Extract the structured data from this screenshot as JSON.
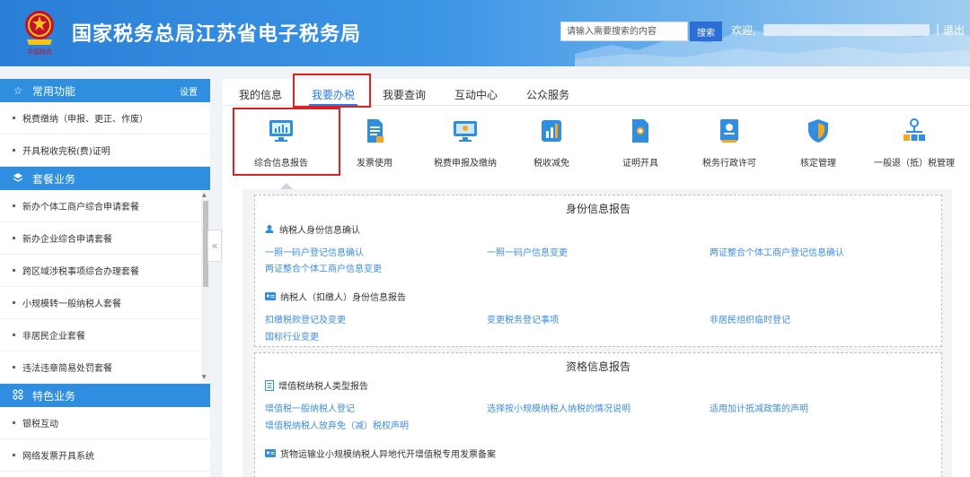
{
  "header": {
    "site_title": "国家税务总局江苏省电子税务局",
    "search_placeholder": "请输入需要搜索的内容",
    "search_button": "搜索",
    "welcome": "欢迎,",
    "separator": "|",
    "logout": "退出"
  },
  "sidebar": {
    "sections": [
      {
        "title": "常用功能",
        "icon": "star-icon",
        "action": "设置",
        "items": [
          "税费缴纳（申报、更正、作废）",
          "开具税收完税(费)证明"
        ]
      },
      {
        "title": "套餐业务",
        "icon": "layers-icon",
        "items": [
          "新办个体工商户综合申请套餐",
          "新办企业综合申请套餐",
          "跨区域涉税事项综合办理套餐",
          "小规模转一般纳税人套餐",
          "非居民企业套餐",
          "违法违章简易处罚套餐"
        ]
      },
      {
        "title": "特色业务",
        "icon": "grid-icon",
        "items": [
          "银税互动",
          "网络发票开具系统"
        ]
      }
    ]
  },
  "tabs": [
    "我的信息",
    "我要办税",
    "我要查询",
    "互动中心",
    "公众服务"
  ],
  "active_tab": "我要办税",
  "functions": [
    {
      "label": "综合信息报告",
      "icon": "monitor-chart-icon"
    },
    {
      "label": "发票使用",
      "icon": "invoice-icon"
    },
    {
      "label": "税费申报及缴纳",
      "icon": "monitor-icon"
    },
    {
      "label": "税收减免",
      "icon": "bar-chart-icon"
    },
    {
      "label": "证明开具",
      "icon": "certificate-icon"
    },
    {
      "label": "税务行政许可",
      "icon": "license-icon"
    },
    {
      "label": "核定管理",
      "icon": "shield-icon"
    },
    {
      "label": "一般退（抵）税管理",
      "icon": "org-tree-icon"
    }
  ],
  "identity_report": {
    "title": "身份信息报告",
    "groups": [
      {
        "heading": "纳税人身份信息确认",
        "links": [
          "一照一码户登记信息确认",
          "一照一码户信息变更",
          "两证整合个体工商户登记信息确认",
          "两证整合个体工商户信息变更"
        ]
      },
      {
        "heading": "纳税人（扣缴人）身份信息报告",
        "links": [
          "扣缴税款登记及变更",
          "变更税务登记事项",
          "非居民组织临时登记",
          "国标行业变更"
        ]
      }
    ]
  },
  "qualification_report": {
    "title": "资格信息报告",
    "groups": [
      {
        "heading": "增值税纳税人类型报告",
        "links": [
          "增值税一般纳税人登记",
          "选择按小规模纳税人纳税的情况说明",
          "适用加计抵减政策的声明",
          "增值税纳税人放弃免（减）税权声明"
        ]
      },
      {
        "heading": "货物运输业小规模纳税人异地代开增值税专用发票备案",
        "links": []
      }
    ]
  },
  "colors": {
    "header_blue": "#2a7fd6",
    "section_blue": "#2f8ee0",
    "active_tab": "#2c7be5",
    "link": "#3d8de0",
    "highlight": "#e02020"
  }
}
